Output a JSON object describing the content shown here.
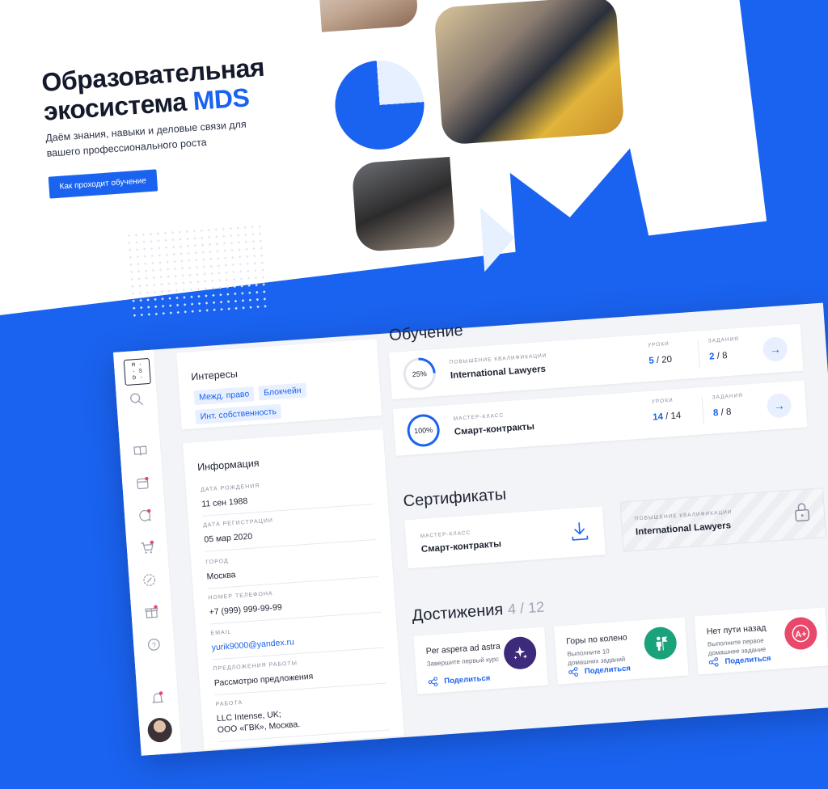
{
  "hero": {
    "title_line1": "Образовательная",
    "title_line2": "экосистема ",
    "title_accent": "MDS",
    "subtitle": "Даём знания, навыки и деловые связи для вашего профессионального роста",
    "button_label": "Как проходит обучение"
  },
  "sidebar": {
    "logo_text": "M·S·D",
    "icons": [
      "search-icon",
      "book-icon",
      "calendar-icon",
      "chat-icon",
      "cart-icon",
      "discount-icon",
      "gift-icon",
      "help-icon",
      "bell-icon"
    ]
  },
  "interests": {
    "title": "Интересы",
    "tags": [
      "Межд. право",
      "Блокчейн",
      "Инт. собственность"
    ]
  },
  "info": {
    "title": "Информация",
    "fields": [
      {
        "label": "ДАТА РОЖДЕНИЯ",
        "value": "11 сен 1988"
      },
      {
        "label": "ДАТА РЕГИСТРАЦИИ",
        "value": "05 мар 2020"
      },
      {
        "label": "ГОРОД",
        "value": "Москва"
      },
      {
        "label": "НОМЕР ТЕЛЕФОНА",
        "value": "+7 (999) 999-99-99"
      },
      {
        "label": "EMAIL",
        "value": "yurik9000@yandex.ru"
      },
      {
        "label": "ПРЕДЛОЖЕНИЯ РАБОТЫ",
        "value": "Рассмотрю предложения"
      },
      {
        "label": "РАБОТА",
        "value_line1": "LLC Intense, UK;",
        "value_line2": "ООО «ГВК», Москва."
      }
    ]
  },
  "learning": {
    "title": "Обучение",
    "lessons_label": "УРОКИ",
    "tasks_label": "ЗАДАНИЯ",
    "courses": [
      {
        "kicker": "ПОВЫШЕНИЕ КВАЛИФИКАЦИИ",
        "name": "International Lawyers",
        "progress_label": "25%",
        "progress": 0.25,
        "lessons_done": "5",
        "lessons_total": "/ 20",
        "tasks_done": "2",
        "tasks_total": "/ 8"
      },
      {
        "kicker": "МАСТЕР-КЛАСС",
        "name": "Смарт-контракты",
        "progress_label": "100%",
        "progress": 1.0,
        "lessons_done": "14",
        "lessons_total": "/ 14",
        "tasks_done": "8",
        "tasks_total": "/ 8"
      }
    ]
  },
  "certificates": {
    "title": "Сертификаты",
    "items": [
      {
        "kicker": "МАСТЕР-КЛАСС",
        "name": "Смарт-контракты",
        "icon": "download-icon"
      },
      {
        "kicker": "ПОВЫШЕНИЕ КВАЛИФИКАЦИИ",
        "name": "International Lawyers",
        "icon": "lock-icon"
      }
    ]
  },
  "achievements": {
    "title": "Достижения",
    "count": "4 / 12",
    "share_label": "Поделиться",
    "items": [
      {
        "title": "Per aspera ad astra",
        "desc": "Завершите первый курс",
        "color": "#3d2a7a",
        "icon": "stars-icon"
      },
      {
        "title": "Горы по колено",
        "desc": "Выполните 10 домашних заданий",
        "color": "#1aa37a",
        "icon": "flag-person-icon"
      },
      {
        "title": "Нет пути назад",
        "desc": "Выполните первое домашнее задание",
        "color": "#e9486b",
        "icon": "grade-a-plus-icon"
      }
    ]
  },
  "colors": {
    "accent": "#1a63f0",
    "text": "#1f2433",
    "muted": "#8b90a0"
  }
}
